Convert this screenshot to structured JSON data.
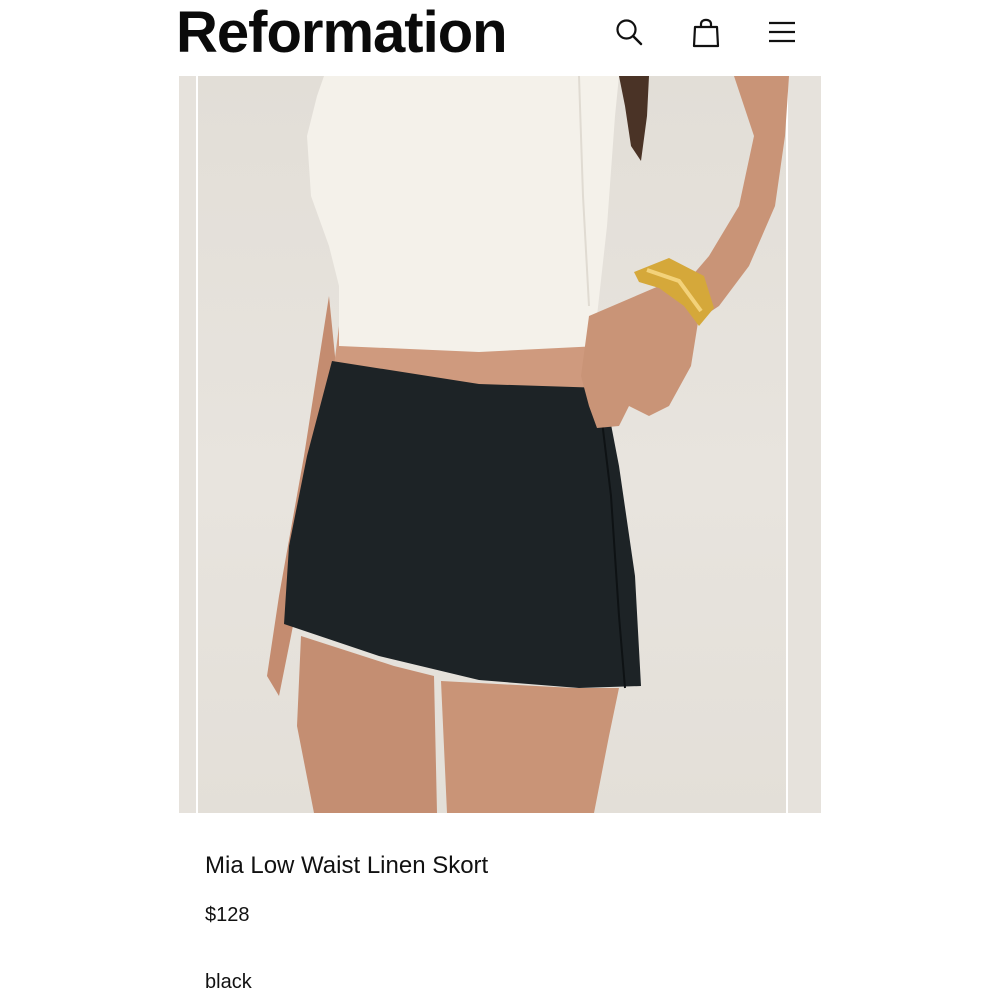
{
  "header": {
    "brand": "Reformation",
    "icons": {
      "search": "search-icon",
      "bag": "shopping-bag-icon",
      "menu": "hamburger-menu-icon"
    }
  },
  "product": {
    "name": "Mia Low Waist Linen Skort",
    "price": "$128",
    "color": "black"
  },
  "colors": {
    "text": "#111111",
    "background": "#ffffff",
    "image_background": "#e6e2dc"
  }
}
